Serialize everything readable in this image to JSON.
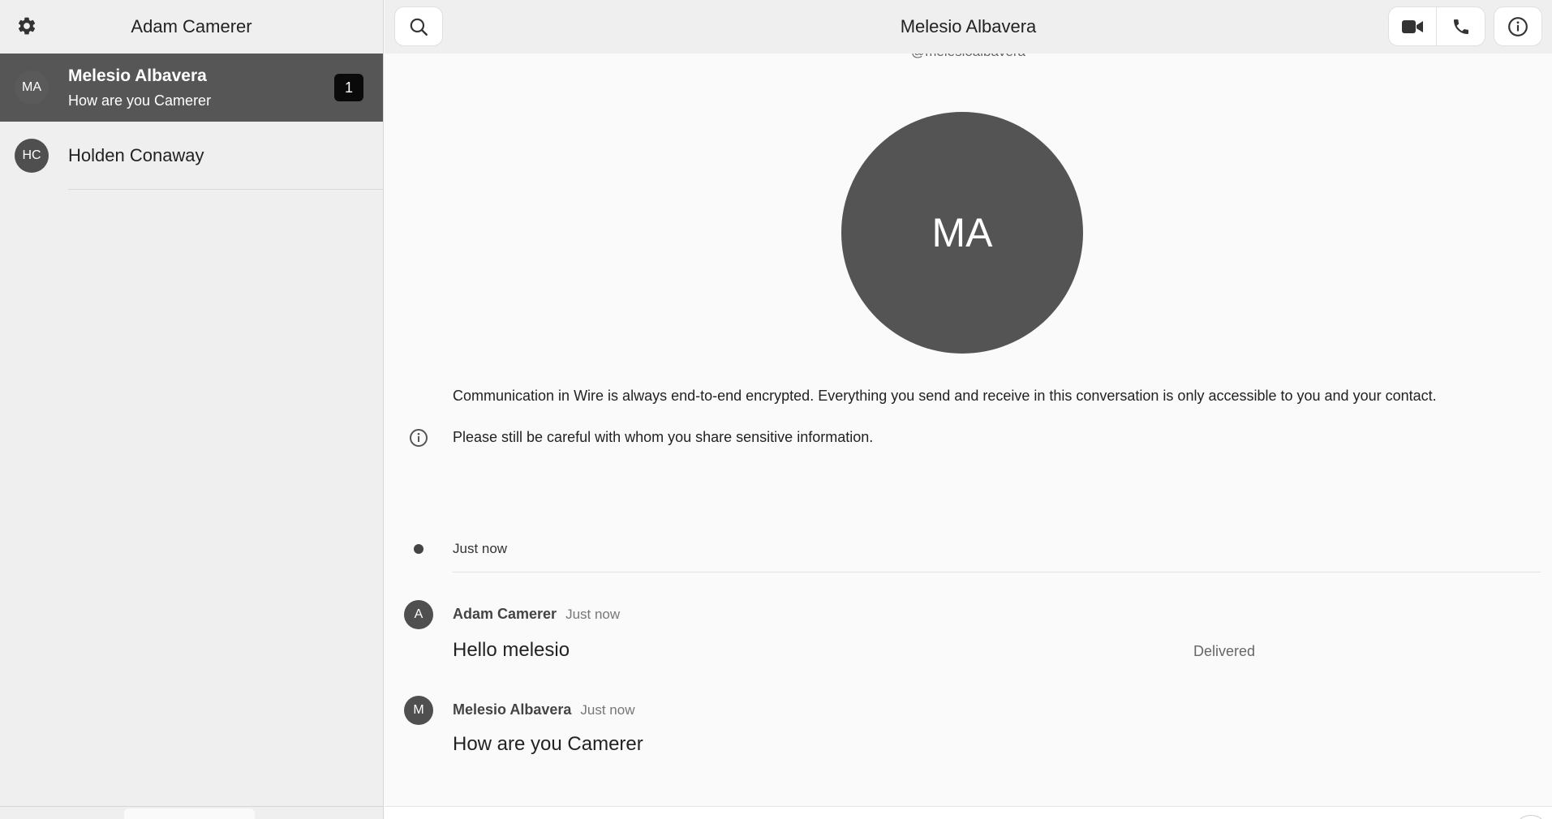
{
  "sidebar": {
    "title": "Adam Camerer",
    "conversations": [
      {
        "initials": "MA",
        "name": "Melesio Albavera",
        "preview": "How are you Camerer",
        "unread": "1",
        "active": true
      },
      {
        "initials": "HC",
        "name": "Holden Conaway",
        "preview": "",
        "unread": "",
        "active": false
      }
    ]
  },
  "conversation": {
    "title": "Melesio Albavera",
    "handle": "@melesioalbavera",
    "avatar_initials": "MA",
    "encryption_notice": "Communication in Wire is always end-to-end encrypted. Everything you send and receive in this conversation is only accessible to you and your contact.",
    "caution_notice": "Please still be careful with whom you share sensitive information.",
    "timestamp_label": "Just now",
    "messages": [
      {
        "avatar": "A",
        "sender": "Adam Camerer",
        "time": "Just now",
        "text": "Hello melesio",
        "status": "Delivered"
      },
      {
        "avatar": "M",
        "sender": "Melesio Albavera",
        "time": "Just now",
        "text": "How are you Camerer",
        "status": ""
      }
    ]
  },
  "icons": {
    "settings": "gear-icon",
    "search": "search-icon",
    "video": "video-camera-icon",
    "call": "phone-icon",
    "info": "info-icon"
  }
}
